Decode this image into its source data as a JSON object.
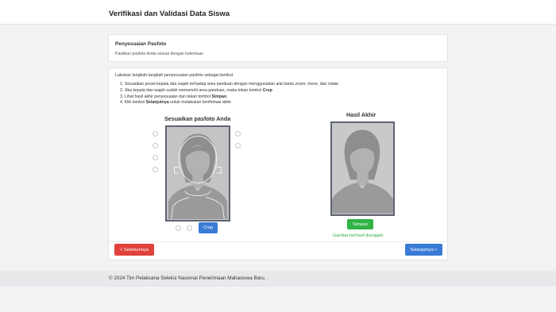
{
  "header": {
    "title": "Verifikasi dan Validasi Data Siswa"
  },
  "section1": {
    "heading": "Penyesuaian Pasfoto",
    "subtitle": "Pastikan pasfoto Anda sesuai dengan ketentuan"
  },
  "instructions": {
    "intro": "Lakukan langkah-langkah penyesuaian pasfoto sebagai berikut",
    "steps": [
      {
        "num": "1.",
        "pre": "Sesuaikan posisi kepala dan wajah terhadap area panduan dengan menggunakan alat bantu zoom, move, dan rotate",
        "bold": "",
        "post": ""
      },
      {
        "num": "2.",
        "pre": "Jika kepala dan wajah sudah memenuhi area panduan, maka tekan tombol ",
        "bold": "Crop",
        "post": ""
      },
      {
        "num": "3.",
        "pre": "Lihat hasil akhir penyesuaian dan tekan tombol ",
        "bold": "Simpan",
        "post": "."
      },
      {
        "num": "4.",
        "pre": "Klik tombol ",
        "bold": "Selanjutnya",
        "post": " untuk melakukan konfirmasi akhir"
      }
    ]
  },
  "editor": {
    "title": "Sesuaikan pasfoto Anda",
    "crop_label": "Crop"
  },
  "result": {
    "title": "Hasil Akhir",
    "save_label": "Simpan",
    "success_message": "Gambar berhasil diunggah"
  },
  "nav": {
    "prev_label": "< Sebelumnya",
    "next_label": "Selanjutnya >"
  },
  "footer": {
    "text": "© 2024 Tim Pelaksana Seleksi Nasional Penerimaan Mahasiswa Baru.   ."
  },
  "colors": {
    "primary": "#3a7bd5",
    "success": "#2fb344",
    "danger": "#e0423c"
  },
  "icons": {
    "photo": "person-silhouette-icon",
    "guide": "face-guide-overlay-icon"
  }
}
